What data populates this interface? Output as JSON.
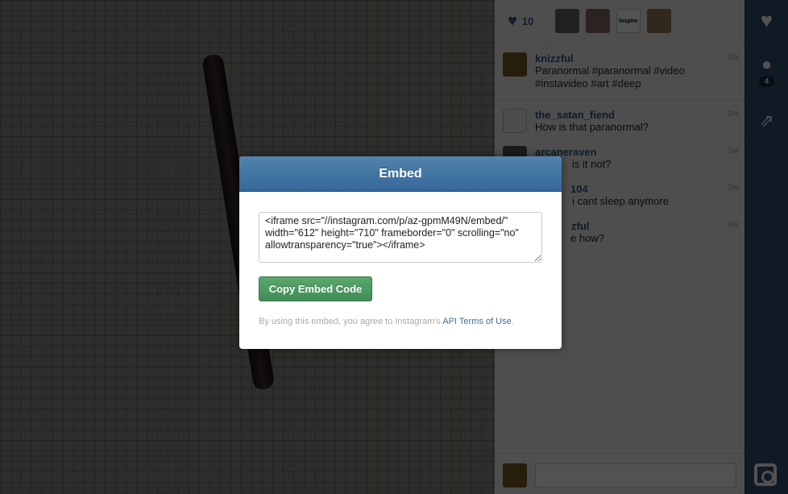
{
  "likes": {
    "icon": "heart-icon",
    "count": "10",
    "likers": [
      {
        "label": ""
      },
      {
        "label": ""
      },
      {
        "label": "Inspire"
      },
      {
        "label": ""
      }
    ]
  },
  "caption": {
    "user": "knizzful",
    "text": "Paranormal #paranormal #video #instavideo #art #deep",
    "time": "3w"
  },
  "comments": [
    {
      "user": "the_satan_fiend",
      "text": "How is that paranormal?",
      "time": "3w"
    },
    {
      "user": "arcaneraven",
      "text": "is it not?",
      "time": "3w"
    },
    {
      "user": "104",
      "text": "i cant sleep anymore",
      "time": "3w"
    },
    {
      "user": "zful",
      "text": "e how?",
      "time": "3w"
    }
  ],
  "comment_input": {
    "placeholder": ""
  },
  "sidebar": {
    "like_icon": "heart-icon",
    "comment_icon": "speech-bubble-icon",
    "comment_count": "4",
    "share_icon": "share-icon",
    "logo_icon": "instagram-camera-icon"
  },
  "modal": {
    "title": "Embed",
    "code": "<iframe src=\"//instagram.com/p/az-gpmM49N/embed/\" width=\"612\" height=\"710\" frameborder=\"0\" scrolling=\"no\" allowtransparency=\"true\"></iframe>",
    "copy_label": "Copy Embed Code",
    "terms_prefix": "By using this embed, you agree to Instagram's ",
    "terms_link": "API Terms of Use",
    "terms_suffix": "."
  },
  "colors": {
    "accent": "#356899",
    "button": "#4a9a60",
    "sidebar": "#30506f"
  }
}
